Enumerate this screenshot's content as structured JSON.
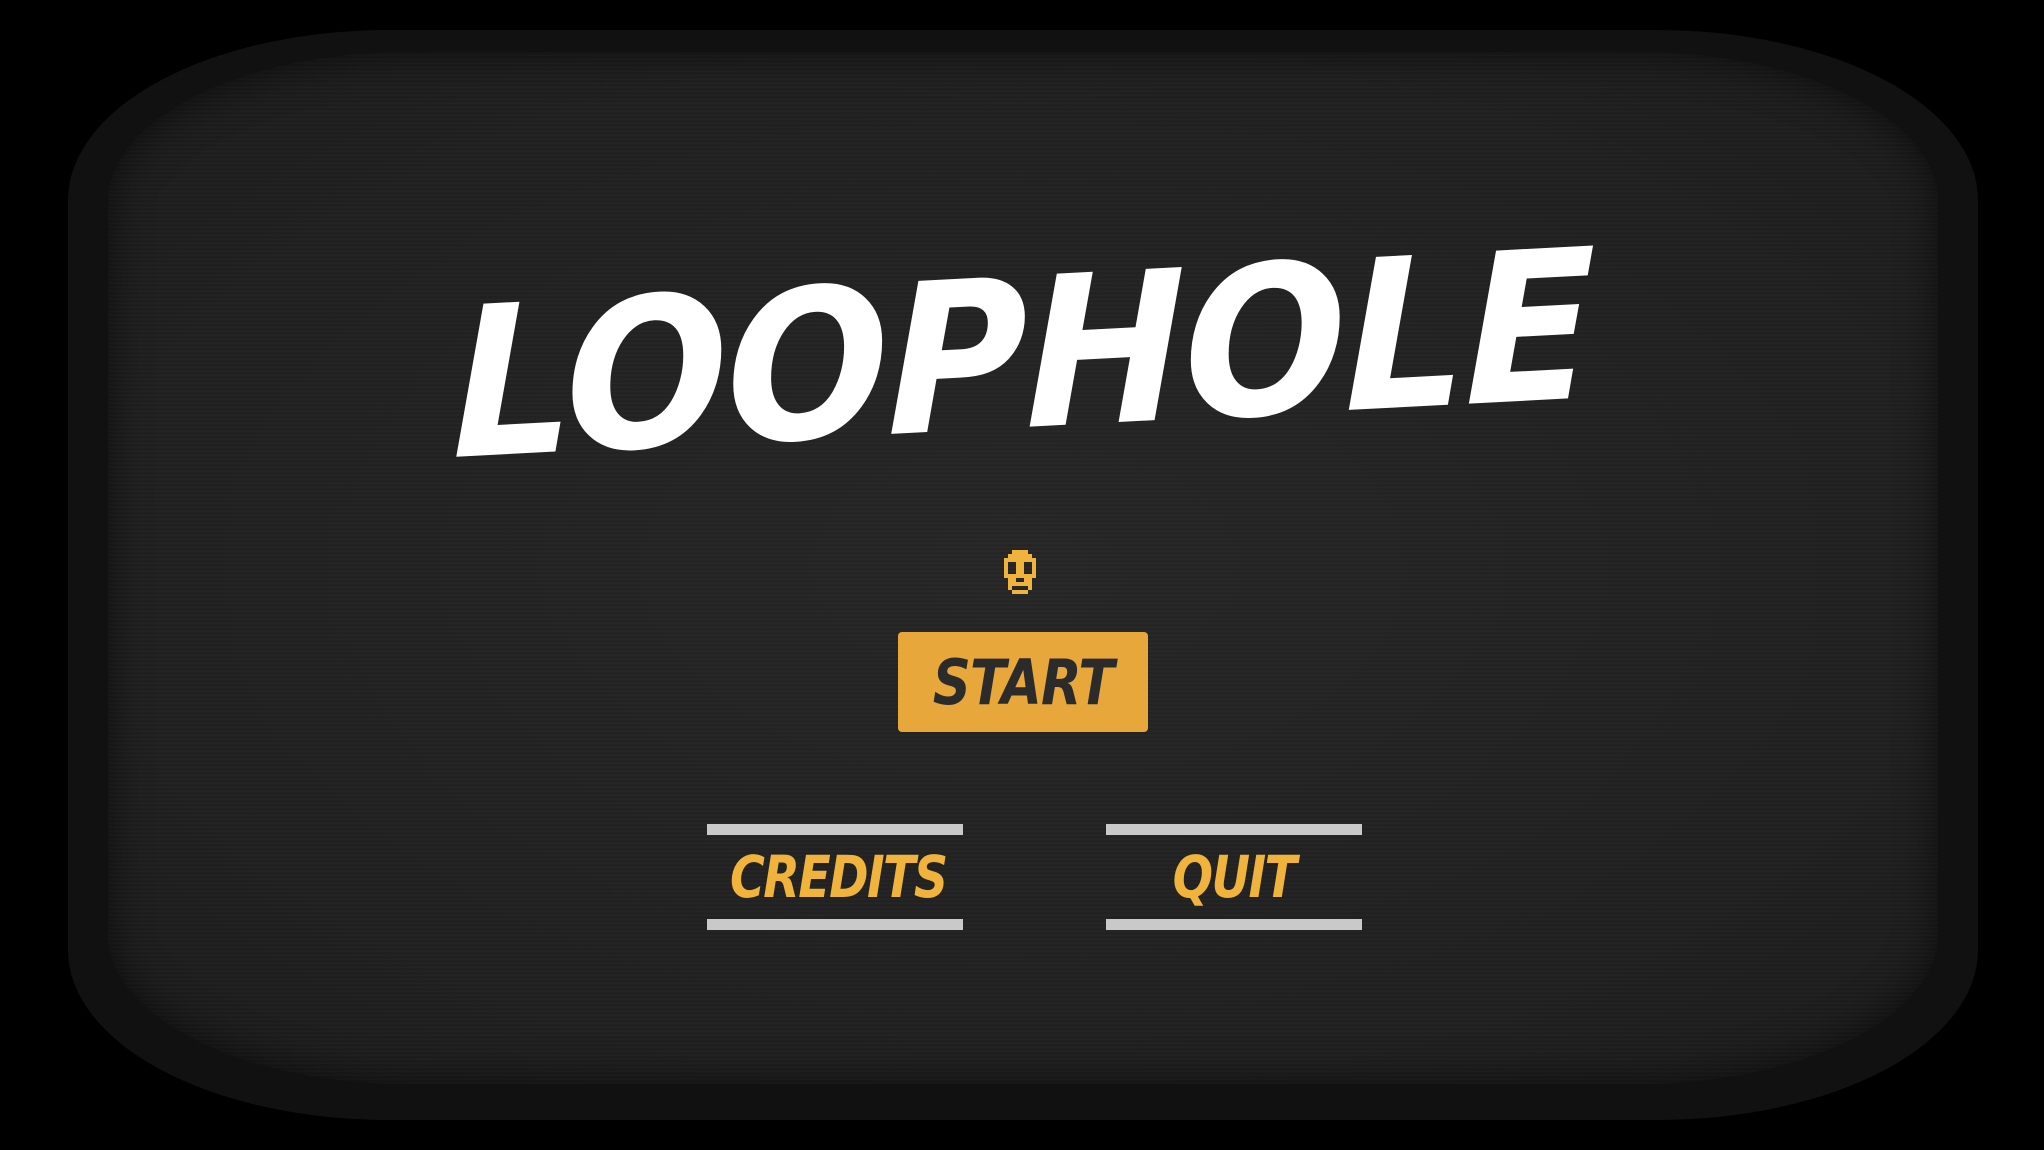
{
  "game": {
    "title": "LOOPHOLE"
  },
  "menu": {
    "start_label": "START",
    "credits_label": "CREDITS",
    "quit_label": "QUIT",
    "selector_icon": "skull-icon"
  },
  "colors": {
    "background": "#000000",
    "screen": "#212121",
    "title": "#ffffff",
    "accent": "#e8a73a",
    "menu_text": "#f0b33c",
    "menu_bars": "#c9c9c9"
  }
}
